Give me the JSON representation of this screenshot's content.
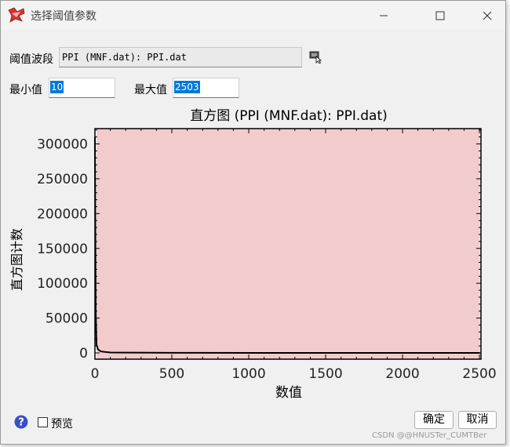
{
  "window": {
    "title": "选择阈值参数",
    "minimize_icon": "minimize-icon",
    "maximize_icon": "maximize-icon",
    "close_icon": "close-icon",
    "app_icon": "envi-app-icon"
  },
  "form": {
    "band_label": "阈值波段",
    "band_value": "PPI (MNF.dat): PPI.dat",
    "min_label": "最小值",
    "min_value": "10",
    "max_label": "最大值",
    "max_value": "2503"
  },
  "chart_data": {
    "type": "area",
    "title": "直方图 (PPI (MNF.dat): PPI.dat)",
    "xlabel": "数值",
    "ylabel": "直方图计数",
    "xlim": [
      0,
      2510
    ],
    "ylim": [
      -9000,
      322000
    ],
    "x_ticks": [
      0,
      500,
      1000,
      1500,
      2000,
      2500
    ],
    "y_ticks": [
      0,
      50000,
      100000,
      150000,
      200000,
      250000,
      300000
    ],
    "selected_range": [
      10,
      2503
    ],
    "highlight_color": "#f2cbcd",
    "line_color": "#000000",
    "points": [
      {
        "x": 0,
        "y": 310000
      },
      {
        "x": 5,
        "y": 60000
      },
      {
        "x": 10,
        "y": 12000
      },
      {
        "x": 20,
        "y": 5000
      },
      {
        "x": 40,
        "y": 2000
      },
      {
        "x": 100,
        "y": 600
      },
      {
        "x": 500,
        "y": 150
      },
      {
        "x": 1000,
        "y": 50
      },
      {
        "x": 2000,
        "y": 10
      },
      {
        "x": 2503,
        "y": 0
      }
    ]
  },
  "footer": {
    "help_icon": "help-icon",
    "preview_label": "预览",
    "ok_label": "确定",
    "cancel_label": "取消"
  },
  "watermark": "CSDN @@HNUSTer_CUMTBer"
}
